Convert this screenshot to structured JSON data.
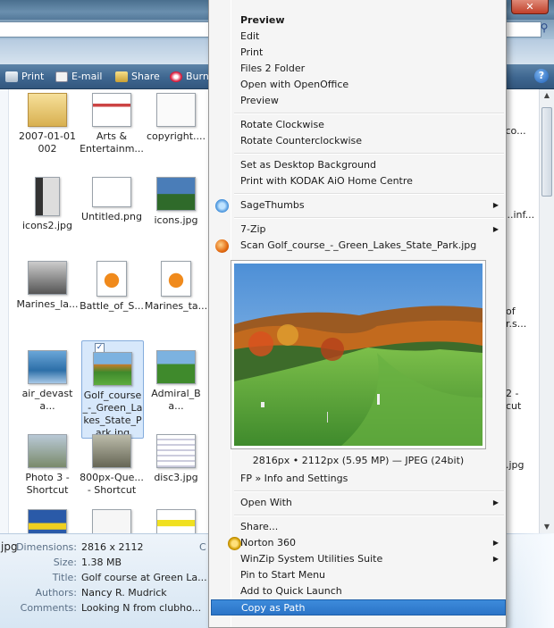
{
  "window": {
    "close_glyph": "✕",
    "search_glyph": "⚲"
  },
  "toolbar": {
    "print": "Print",
    "email": "E-mail",
    "share": "Share",
    "burn": "Burn",
    "help": "?"
  },
  "tiles": [
    {
      "label": "2007-01-01\n002"
    },
    {
      "label": "Arts &\nEntertainm..."
    },
    {
      "label": "copyright...."
    },
    {
      "label": "icons2.jpg"
    },
    {
      "label": "Untitled.png"
    },
    {
      "label": "icons.jpg"
    },
    {
      "label": "Marines_la..."
    },
    {
      "label": "Battle_of_S..."
    },
    {
      "label": "Marines_ta..."
    },
    {
      "label": "air_devasta..."
    },
    {
      "label": "Golf_course_-_Green_Lakes_State_Park.jpg"
    },
    {
      "label": "Admiral_Ba..."
    },
    {
      "label": "Photo 3 -\nShortcut"
    },
    {
      "label": "800px-Que...\n- Shortcut"
    },
    {
      "label": "disc3.jpg"
    }
  ],
  "right_tiles": [
    ".co...",
    "...inf...",
    "of\nr.s...",
    "2 -\ncut",
    ".jpg"
  ],
  "details": {
    "filename_fragment": "jpg",
    "rows": [
      {
        "key": "Dimensions:",
        "value": "2816 x 2112"
      },
      {
        "key": "Size:",
        "value": "1.38 MB"
      },
      {
        "key": "Title:",
        "value": "Golf course at Green La..."
      },
      {
        "key": "Authors:",
        "value": "Nancy R. Mudrick"
      },
      {
        "key": "Comments:",
        "value": "Looking N from clubho..."
      }
    ],
    "extra_key": "C"
  },
  "menu": {
    "preview_bold": "Preview",
    "edit": "Edit",
    "print": "Print",
    "files2folder": "Files 2 Folder",
    "open_oo": "Open with OpenOffice",
    "preview": "Preview",
    "rotate_cw": "Rotate Clockwise",
    "rotate_ccw": "Rotate Counterclockwise",
    "set_bg": "Set as Desktop Background",
    "print_kodak": "Print with KODAK AiO Home Centre",
    "sagethumbs": "SageThumbs",
    "sevenzip": "7-Zip",
    "scan": "Scan Golf_course_-_Green_Lakes_State_Park.jpg",
    "preview_caption": "2816px • 2112px (5.95 MP) — JPEG (24bit)",
    "fp_info": "FP » Info and Settings",
    "open_with": "Open With",
    "share": "Share...",
    "norton": "Norton 360",
    "winzip": "WinZip System Utilities Suite",
    "pin_start": "Pin to Start Menu",
    "quick_launch": "Add to Quick Launch",
    "copy_path": "Copy as Path",
    "submenu_arrow": "▶"
  },
  "colors": {
    "highlight": "#2b74c7",
    "toolbar": "#3e6690"
  }
}
